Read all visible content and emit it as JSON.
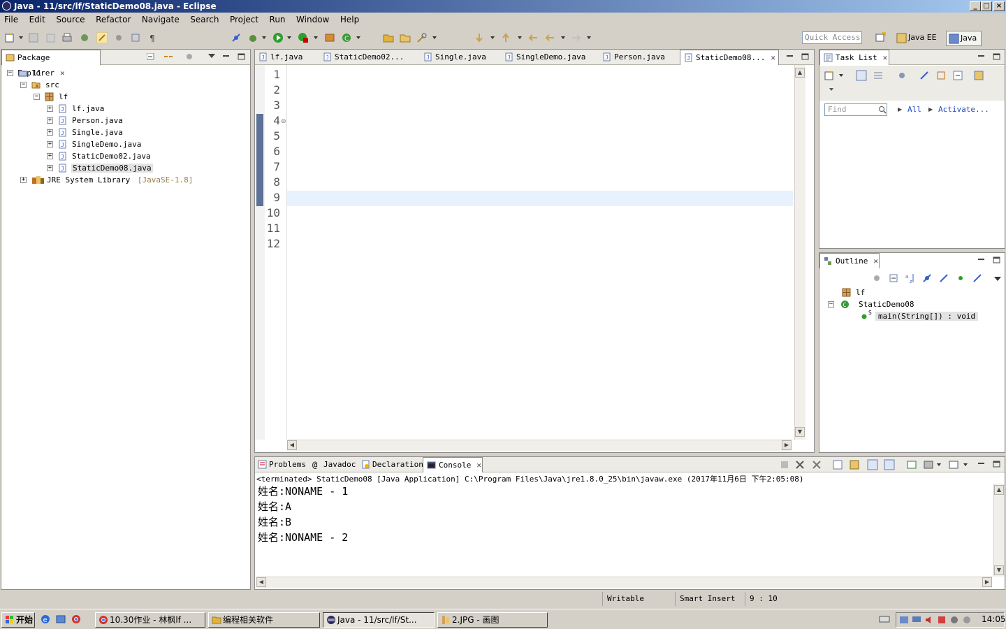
{
  "window": {
    "title": "Java - 11/src/lf/StaticDemo08.java - Eclipse",
    "controls": [
      "_",
      "□",
      "×"
    ]
  },
  "menu": [
    "File",
    "Edit",
    "Source",
    "Refactor",
    "Navigate",
    "Search",
    "Project",
    "Run",
    "Window",
    "Help"
  ],
  "toolbar": {
    "quick_access_placeholder": "Quick Access",
    "perspectives": [
      "Java EE",
      "Java"
    ]
  },
  "package_explorer": {
    "tab": "Package Explorer",
    "tree": [
      {
        "label": "11",
        "extra": ""
      },
      {
        "label": "src",
        "extra": ""
      },
      {
        "label": "lf",
        "extra": ""
      },
      {
        "label": "lf.java",
        "extra": ""
      },
      {
        "label": "Person.java",
        "extra": ""
      },
      {
        "label": "Single.java",
        "extra": ""
      },
      {
        "label": "SingleDemo.java",
        "extra": ""
      },
      {
        "label": "StaticDemo02.java",
        "extra": ""
      },
      {
        "label": "StaticDemo08.java",
        "extra": ""
      },
      {
        "label": "JRE System Library",
        "extra": "[JavaSE-1.8]"
      }
    ]
  },
  "editor": {
    "tabs": [
      "lf.java",
      "StaticDemo02...",
      "Single.java",
      "SingleDemo.java",
      "Person.java",
      "StaticDemo08..."
    ],
    "line_numbers": [
      "1",
      "2",
      "3",
      "4",
      "5",
      "6",
      "7",
      "8",
      "9",
      "10",
      "11",
      "12"
    ]
  },
  "task_list": {
    "tab": "Task List",
    "find_placeholder": "Find",
    "all": "All",
    "activate": "Activate..."
  },
  "outline": {
    "tab": "Outline",
    "package": "lf",
    "class": "StaticDemo08",
    "method": "main(String[]) : void"
  },
  "console": {
    "tabs": [
      "Problems",
      "Javadoc",
      "Declaration",
      "Console"
    ],
    "header": "<terminated> StaticDemo08 [Java Application] C:\\Program Files\\Java\\jre1.8.0_25\\bin\\javaw.exe (2017年11月6日 下午2:05:08)",
    "output": [
      "姓名:NONAME - 1",
      "姓名:A",
      "姓名:B",
      "姓名:NONAME - 2"
    ]
  },
  "status": {
    "writable": "Writable",
    "insert_mode": "Smart Insert",
    "position": "9 : 10"
  },
  "taskbar": {
    "start": "开始",
    "tasks": [
      "10.30作业 - 林枫lf ...",
      "编程相关软件",
      "Java - 11/src/lf/St...",
      "2.JPG - 画图"
    ],
    "clock": "14:05"
  },
  "colors": {
    "keyword": "#7f0055",
    "static_field": "#0000c0",
    "string": "#2a00ff",
    "title_bar": "#0a246a"
  }
}
